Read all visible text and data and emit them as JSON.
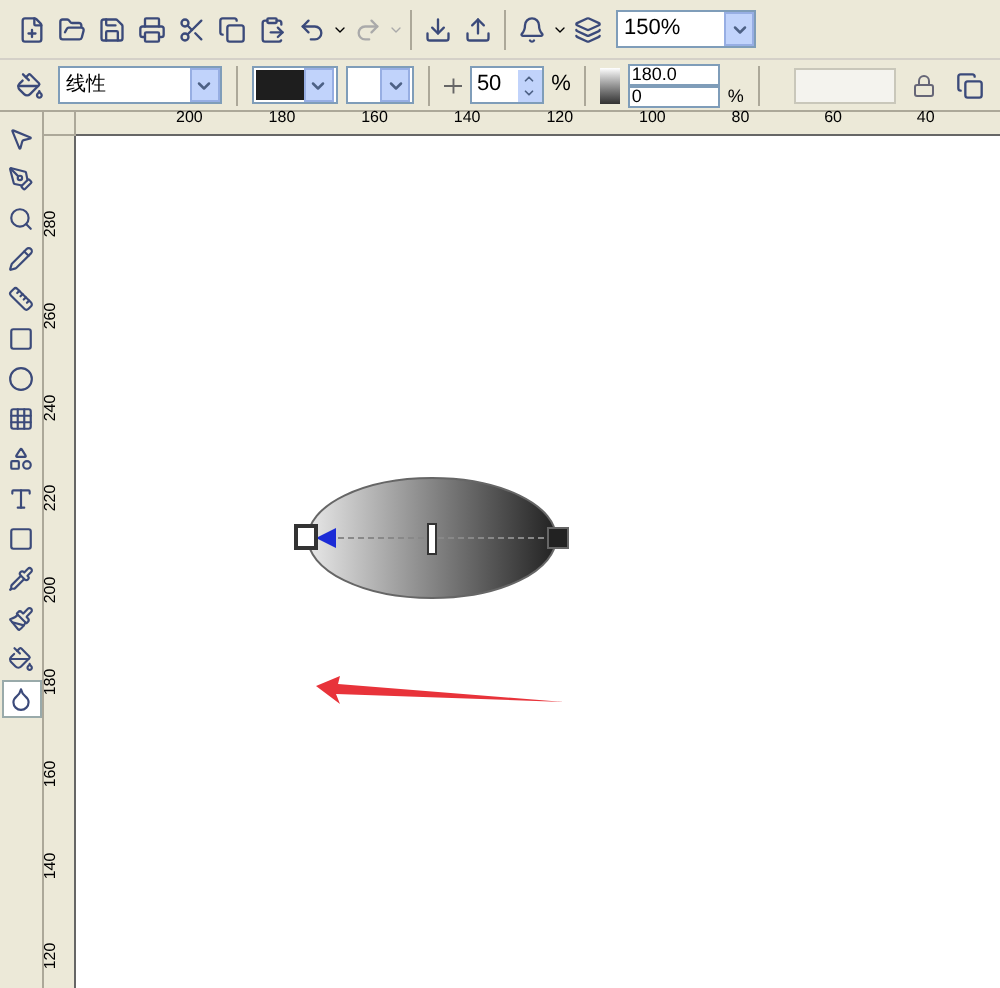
{
  "standard_toolbar": {
    "zoom": "150%"
  },
  "property_bar": {
    "fill_type": "线性",
    "midpoint": "50",
    "midpoint_unit": "%",
    "angle": "180.0",
    "edge_pad": "0",
    "edge_pad_unit": "%"
  },
  "horizontal_ruler": {
    "labels": [
      "200",
      "180",
      "160",
      "140",
      "120",
      "100",
      "80",
      "60",
      "40"
    ]
  },
  "vertical_ruler": {
    "labels": [
      "280",
      "260",
      "240",
      "220",
      "200",
      "180",
      "160",
      "140",
      "120"
    ]
  },
  "toolbox": [
    {
      "kind": "pick",
      "selected": false
    },
    {
      "kind": "shape",
      "selected": false
    },
    {
      "kind": "zoom",
      "selected": false
    },
    {
      "kind": "freehand",
      "selected": false
    },
    {
      "kind": "dimension",
      "selected": false
    },
    {
      "kind": "rectangle",
      "selected": false
    },
    {
      "kind": "ellipse",
      "selected": false
    },
    {
      "kind": "grid",
      "selected": false
    },
    {
      "kind": "shapes",
      "selected": false
    },
    {
      "kind": "text",
      "selected": false
    },
    {
      "kind": "shadow",
      "selected": false
    },
    {
      "kind": "eyedropper",
      "selected": false
    },
    {
      "kind": "outline",
      "selected": false
    },
    {
      "kind": "fill",
      "selected": false
    },
    {
      "kind": "interactive-fill",
      "selected": true
    }
  ]
}
